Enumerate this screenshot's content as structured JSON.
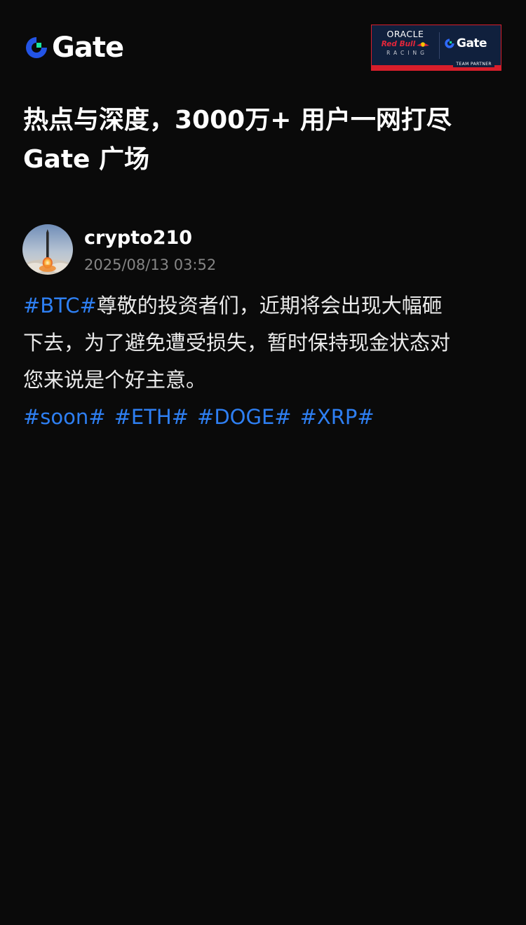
{
  "header": {
    "brand": "Gate",
    "partner": {
      "oracle": "ORACLE",
      "redbull": "Red Bull",
      "racing": "RACING",
      "brand": "Gate",
      "band_label": "TEAM PARTNER"
    }
  },
  "headline": {
    "line1": "热点与深度，3000万+ 用户一网打尽",
    "line2": "Gate 广场"
  },
  "post": {
    "author": {
      "username": "crypto210",
      "timestamp": "2025/08/13 03:52"
    },
    "body": {
      "lead_tag": "#BTC#",
      "line1_text": "尊敬的投资者们，近期将会出现大幅砸",
      "line2_text": "下去，为了避免遭受损失，暂时保持现金状态对",
      "line3_text": "您来说是个好主意。"
    },
    "tags": [
      "#soon#",
      "#ETH#",
      "#DOGE#",
      "#XRP#"
    ]
  },
  "colors": {
    "background": "#0a0a0a",
    "brand_blue": "#2354e6",
    "brand_green": "#17e6a1",
    "tag_blue": "#2e7ff2",
    "muted_text": "#858585",
    "partner_navy": "#10203d",
    "partner_red": "#d81e2b"
  },
  "icons": {
    "logo": "gate-logo-icon",
    "avatar": "rocket-launch-avatar"
  }
}
